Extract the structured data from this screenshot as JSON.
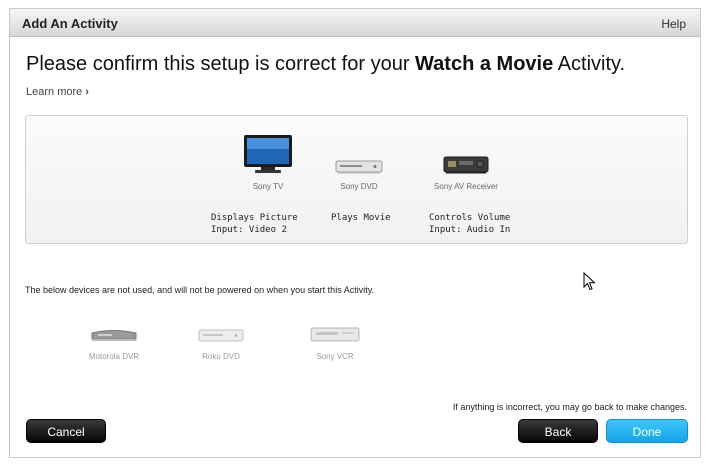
{
  "dialog": {
    "title": "Add An Activity",
    "help": "Help"
  },
  "confirm": {
    "prefix": "Please confirm this setup is correct for your ",
    "activity": "Watch a Movie",
    "suffix": " Activity.",
    "learn_more": "Learn more",
    "learn_more_icon": "chevron-right-icon"
  },
  "devices": [
    {
      "name": "Sony TV",
      "role": "Displays Picture",
      "input": "Input: Video 2",
      "icon": "tv-icon"
    },
    {
      "name": "Sony DVD",
      "role": "Plays Movie",
      "input": "",
      "icon": "dvd-player-icon"
    },
    {
      "name": "Sony AV Receiver",
      "role": "Controls Volume",
      "input": "Input: Audio In",
      "icon": "av-receiver-icon"
    }
  ],
  "unused": {
    "note": "The below devices are not used, and will not be powered on when you start this Activity.",
    "devices": [
      {
        "name": "Motorola DVR",
        "icon": "dvr-icon"
      },
      {
        "name": "Roku DVD",
        "icon": "dvd-player-icon"
      },
      {
        "name": "Sony VCR",
        "icon": "vcr-icon"
      }
    ]
  },
  "footer": {
    "note": "If anything is incorrect, you may go back to make changes.",
    "cancel": "Cancel",
    "back": "Back",
    "done": "Done"
  }
}
